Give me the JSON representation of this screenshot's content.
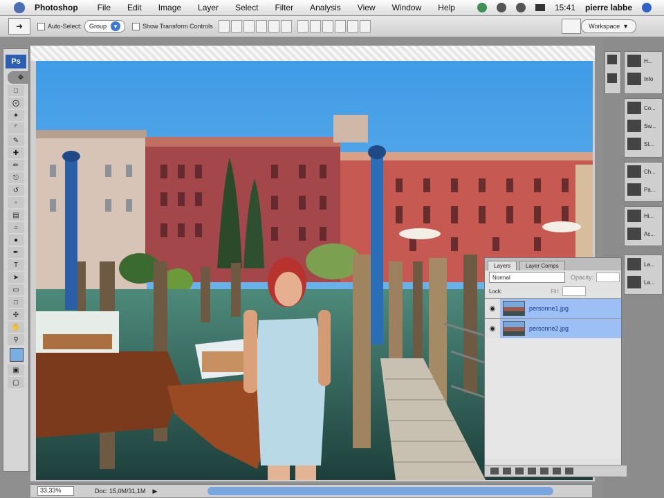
{
  "menubar": {
    "app": "Photoshop",
    "items": [
      "File",
      "Edit",
      "Image",
      "Layer",
      "Select",
      "Filter",
      "Analysis",
      "View",
      "Window",
      "Help"
    ],
    "clock": "15:41",
    "user": "pierre labbe"
  },
  "options": {
    "auto_select_label": "Auto-Select:",
    "auto_select_value": "Group",
    "show_transform_label": "Show Transform Controls",
    "workspace_label": "Workspace"
  },
  "toolbox": {
    "logo": "Ps",
    "foreground_color": "#7aaee3"
  },
  "status": {
    "zoom": "33,33%",
    "doc_info": "Doc: 15,0M/31,1M"
  },
  "dock": {
    "items": [
      "H...",
      "Info",
      "Co...",
      "Sw...",
      "St...",
      "Ch...",
      "Pa...",
      "Hi...",
      "Ac...",
      "La...",
      "La..."
    ]
  },
  "layers_panel": {
    "tabs": [
      "Layers",
      "Layer Comps"
    ],
    "blend_mode": "Normal",
    "opacity_label": "Opacity:",
    "lock_label": "Lock:",
    "fill_label": "Fill:",
    "layers": [
      {
        "name": "personne1.jpg",
        "visible": true
      },
      {
        "name": "personne2.jpg",
        "visible": true
      }
    ]
  }
}
